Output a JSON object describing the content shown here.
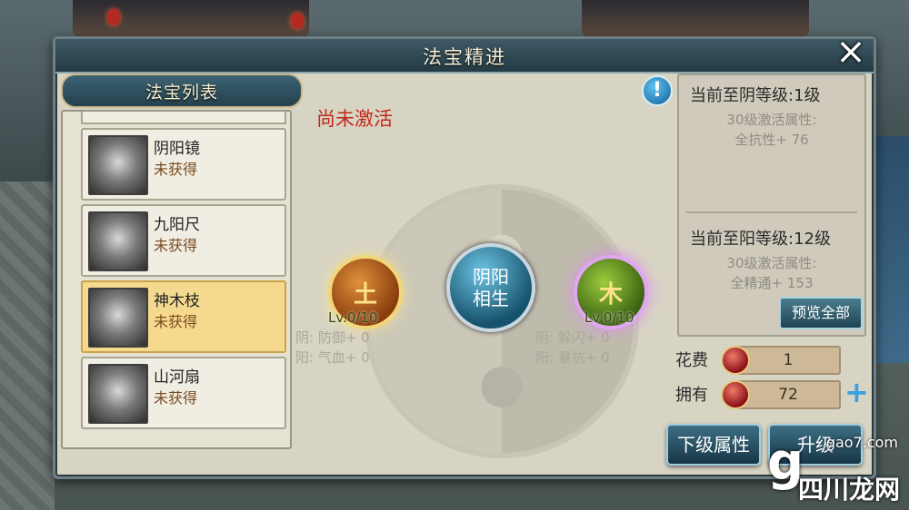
{
  "window": {
    "title": "法宝精进",
    "close_icon": "×"
  },
  "list": {
    "header": "法宝列表",
    "items": [
      {
        "name": "阴阳镜",
        "status": "未获得",
        "selected": false
      },
      {
        "name": "九阳尺",
        "status": "未获得",
        "selected": false
      },
      {
        "name": "神木枝",
        "status": "未获得",
        "selected": true
      },
      {
        "name": "山河扇",
        "status": "未获得",
        "selected": false
      }
    ]
  },
  "center": {
    "status": "尚未激活",
    "center_orb": {
      "line1": "阴阳",
      "line2": "相生"
    },
    "left_orb": {
      "glyph": "土",
      "level": "Lv.0/10",
      "stats": [
        "阴: 防御+ 0",
        "阳: 气血+ 0"
      ]
    },
    "right_orb": {
      "glyph": "木",
      "level": "Lv.0/10",
      "stats": [
        "阴: 躲闪+ 0",
        "阳: 暴抗+ 0"
      ]
    }
  },
  "info": {
    "info_icon": "!",
    "yin": {
      "title": "当前至阴等级:1级",
      "sub1": "30级激活属性:",
      "sub2": "全抗性+ 76"
    },
    "yang": {
      "title": "当前至阳等级:12级",
      "sub1": "30级激活属性:",
      "sub2": "全精通+ 153"
    },
    "preview_button": "预览全部"
  },
  "cost": {
    "cost_label": "花费",
    "cost_value": "1",
    "own_label": "拥有",
    "own_value": "72",
    "plus": "+"
  },
  "buttons": {
    "next_attr": "下级属性",
    "upgrade": "升级"
  },
  "watermark": {
    "site": "gao7.com",
    "brand": "四川龙网",
    "letter": "g"
  },
  "colors": {
    "status_red": "#c0281c",
    "selected_item": "#f5d98e",
    "panel_bg": "#d8d4c4"
  }
}
